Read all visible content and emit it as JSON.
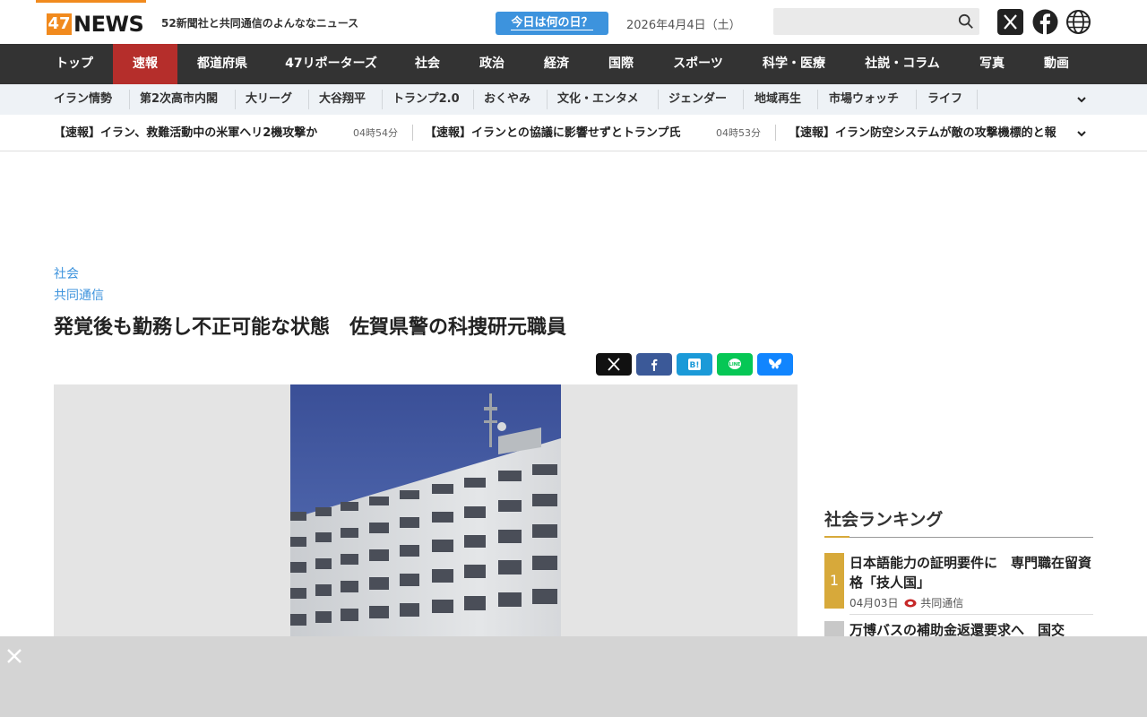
{
  "header": {
    "logo_number": "47",
    "logo_word": "NEWS",
    "tagline": "52新聞社と共同通信のよんななニュース",
    "today_button": "今日は何の日？",
    "date": "2026年4月4日（土）",
    "search_placeholder": ""
  },
  "main_nav": [
    {
      "label": "トップ"
    },
    {
      "label": "速報"
    },
    {
      "label": "都道府県"
    },
    {
      "label": "47リポーターズ"
    },
    {
      "label": "社会"
    },
    {
      "label": "政治"
    },
    {
      "label": "経済"
    },
    {
      "label": "国際"
    },
    {
      "label": "スポーツ"
    },
    {
      "label": "科学・医療"
    },
    {
      "label": "社説・コラム"
    },
    {
      "label": "写真"
    },
    {
      "label": "動画"
    }
  ],
  "sub_nav": [
    {
      "label": "イラン情勢"
    },
    {
      "label": "第2次高市内閣"
    },
    {
      "label": "大リーグ"
    },
    {
      "label": "大谷翔平"
    },
    {
      "label": "トランプ2.0"
    },
    {
      "label": "おくやみ"
    },
    {
      "label": "文化・エンタメ"
    },
    {
      "label": "ジェンダー"
    },
    {
      "label": "地域再生"
    },
    {
      "label": "市場ウォッチ"
    },
    {
      "label": "ライフ"
    }
  ],
  "ticker": [
    {
      "text": "【速報】イラン、救難活動中の米軍ヘリ2機攻撃か",
      "time": "04時54分"
    },
    {
      "text": "【速報】イランとの協議に影響せずとトランプ氏",
      "time": "04時53分"
    },
    {
      "text": "【速報】イラン防空システムが敵の攻撃機標的と報",
      "time": ""
    }
  ],
  "article": {
    "category": "社会",
    "source": "共同通信",
    "headline": "発覚後も勤務し不正可能な状態　佐賀県警の科捜研元職員"
  },
  "ranking": {
    "title": "社会ランキング",
    "items": [
      {
        "rank": "1",
        "title": "日本語能力の証明要件に　専門職在留資格「技人国」",
        "date": "04月03日",
        "source": "共同通信"
      },
      {
        "rank": "",
        "title": "万博バスの補助金返還要求へ　国交",
        "date": "",
        "source": ""
      }
    ]
  },
  "colors": {
    "brand_orange": "#f18a1e",
    "nav_dark": "#333333",
    "nav_active": "#b52e2b",
    "link_blue": "#3d93dd",
    "rank_gold": "#d7a93a"
  }
}
